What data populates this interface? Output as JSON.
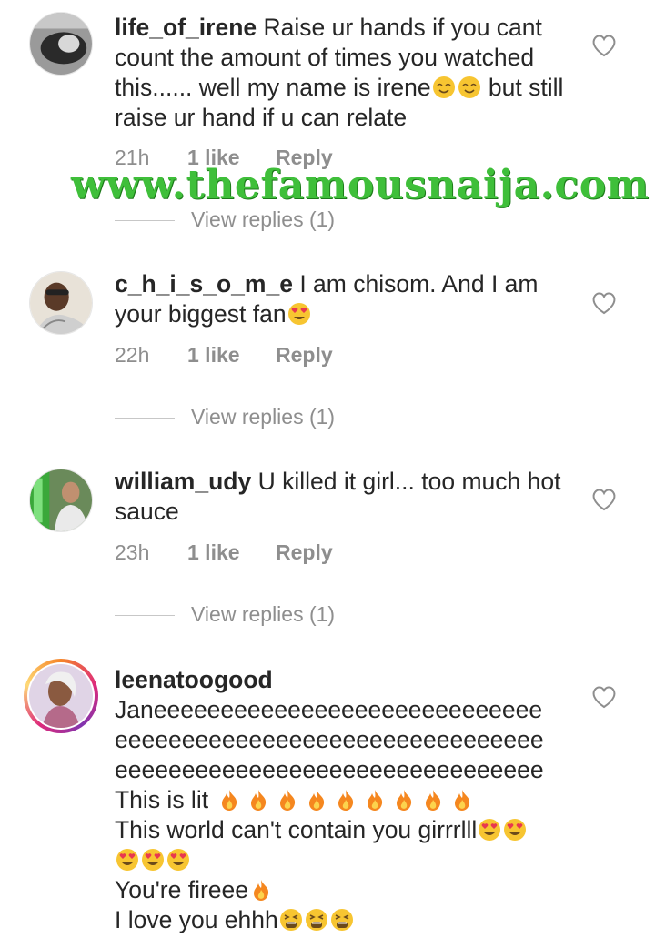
{
  "comments": [
    {
      "username": "life_of_irene",
      "text": "Raise ur hands if you cant count the amount of times you watched this...... well my name is irene",
      "text_after": " but still raise ur hand if u can relate",
      "time": "21h",
      "likes": "1 like",
      "reply": "Reply",
      "view_replies": "View replies (1)"
    },
    {
      "username": "c_h_i_s_o_m_e",
      "text": "I am chisom. And I am your biggest fan",
      "time": "22h",
      "likes": "1 like",
      "reply": "Reply",
      "view_replies": "View replies (1)"
    },
    {
      "username": "william_udy",
      "text": "U killed it girl... too much hot sauce",
      "time": "23h",
      "likes": "1 like",
      "reply": "Reply",
      "view_replies": "View replies (1)"
    },
    {
      "username": "leenatoogood",
      "line1": "Janeeeeeeeeeeeeeeeeeeeeeeeeeeeee",
      "line2": "eeeeeeeeeeeeeeeeeeeeeeeeeeeeeeee",
      "line3": "eeeeeeeeeeeeeeeeeeeeeeeeeeeeeeee",
      "line4": "This is lit",
      "line5": "This world can't contain you girrrlll",
      "line7": "You're fireee",
      "line8": "I love you ehhh"
    }
  ],
  "watermark": "www.thefamousnaija.com",
  "icons": {
    "heart": "heart-outline-icon",
    "smile": "smiling-face-emoji",
    "heart_eyes": "heart-eyes-emoji",
    "fire": "fire-emoji",
    "tired": "tired-face-emoji"
  },
  "colors": {
    "text": "#262626",
    "meta": "#8e8e8e",
    "watermark": "#3fbf3a"
  }
}
